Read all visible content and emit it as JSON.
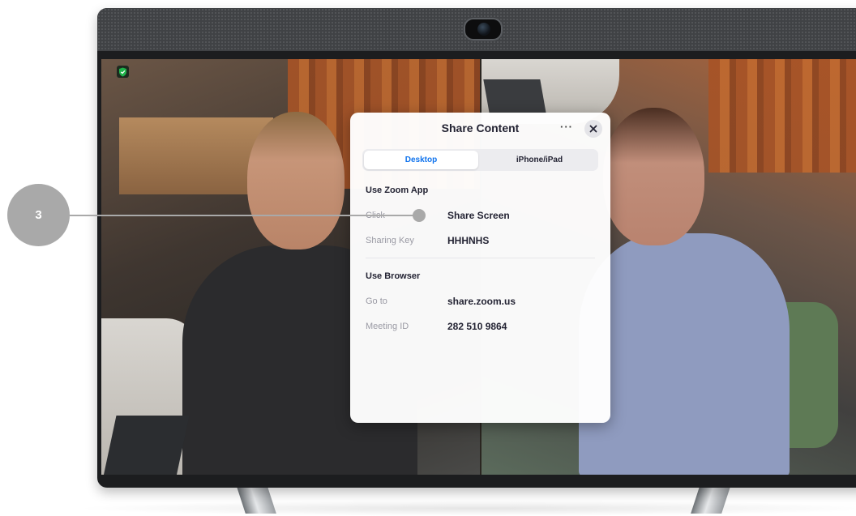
{
  "callout": {
    "number": "3"
  },
  "dialog": {
    "title": "Share Content",
    "more_label": "···",
    "tabs": [
      {
        "label": "Desktop",
        "active": true
      },
      {
        "label": "iPhone/iPad",
        "active": false
      }
    ],
    "zoom_app": {
      "heading": "Use Zoom App",
      "rows": [
        {
          "label": "Click",
          "value": "Share Screen"
        },
        {
          "label": "Sharing Key",
          "value": "HHHNHS"
        }
      ]
    },
    "browser": {
      "heading": "Use Browser",
      "rows": [
        {
          "label": "Go to",
          "value": "share.zoom.us"
        },
        {
          "label": "Meeting ID",
          "value": "282 510 9864"
        }
      ]
    }
  },
  "icons": {
    "security": "shield-check-icon",
    "close": "close-icon",
    "more": "more-horizontal-icon",
    "camera": "camera-icon"
  },
  "colors": {
    "accent": "#0e72ed",
    "shield": "#1fb34a",
    "callout": "#a9a9a9"
  }
}
